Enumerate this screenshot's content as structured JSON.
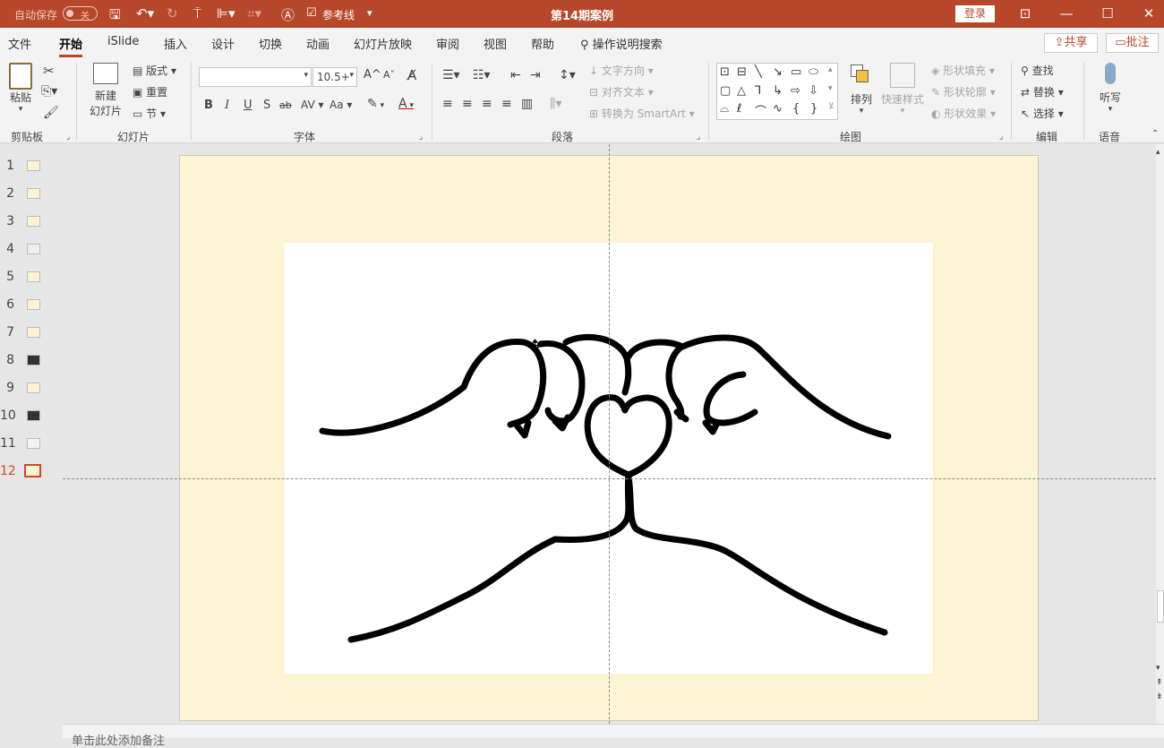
{
  "titlebar": {
    "autosave_label": "自动保存",
    "autosave_state": "关",
    "reference_line_label": "参考线",
    "doc_title": "第14期案例",
    "login_label": "登录"
  },
  "menu": {
    "items": [
      "文件",
      "开始",
      "iSlide",
      "插入",
      "设计",
      "切换",
      "动画",
      "幻灯片放映",
      "审阅",
      "视图",
      "帮助"
    ],
    "active": "开始",
    "tell_me": "操作说明搜索",
    "share": "共享",
    "comment": "批注"
  },
  "ribbon": {
    "clipboard": {
      "paste": "粘贴",
      "group": "剪贴板"
    },
    "slides": {
      "new_slide_1": "新建",
      "new_slide_2": "幻灯片",
      "layout": "版式",
      "reset": "重置",
      "section": "节",
      "group": "幻灯片"
    },
    "font": {
      "font_name": "",
      "font_size": "10.5+",
      "group": "字体",
      "bold": "B",
      "italic": "I",
      "underline": "U",
      "shadow": "S",
      "strike": "ab",
      "spacing": "AV",
      "case": "Aa",
      "grow": "A",
      "shrink": "A"
    },
    "paragraph": {
      "text_direction": "文字方向",
      "align_text": "对齐文本",
      "smartart": "转换为 SmartArt",
      "group": "段落"
    },
    "drawing": {
      "arrange": "排列",
      "quick_styles": "快速样式",
      "fill": "形状填充",
      "outline": "形状轮廓",
      "effects": "形状效果",
      "group": "绘图"
    },
    "editing": {
      "find": "查找",
      "replace": "替换",
      "select": "选择",
      "group": "编辑"
    },
    "voice": {
      "dictate": "听写",
      "group": "语音"
    }
  },
  "slides_panel": {
    "numbers": [
      "1",
      "2",
      "3",
      "4",
      "5",
      "6",
      "7",
      "8",
      "9",
      "10",
      "11",
      "12"
    ],
    "dark": [
      8,
      10
    ],
    "active": 12
  },
  "notes_placeholder": "单击此处添加备注",
  "colors": {
    "accent": "#b7472a",
    "slide_bg": "#fdf4d4",
    "active_thumb": "#d24726"
  }
}
